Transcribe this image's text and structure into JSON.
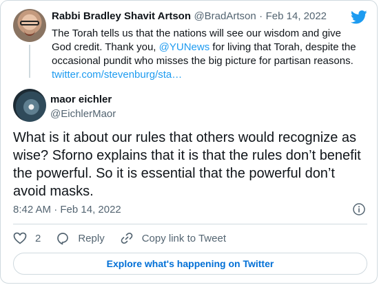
{
  "quoted_tweet": {
    "author_name": "Rabbi Bradley Shavit Artson",
    "author_handle": "@BradArtson",
    "separator": "·",
    "date": "Feb 14, 2022",
    "text_before_mention": "The Torah tells us that the nations will see our wisdom and give God credit. Thank you, ",
    "mention": "@YUNews",
    "text_after_mention": " for living that Torah, despite the occasional pundit who misses the big picture for partisan reasons.",
    "link": "twitter.com/stevenburg/sta…"
  },
  "main_tweet": {
    "author_name": "maor eichler",
    "author_handle": "@EichlerMaor",
    "text": "What is it about our rules that others would recognize as wise? Sforno explains that it is that the rules don’t benefit the powerful. So it is essential that the powerful don’t avoid masks.",
    "timestamp": "8:42 AM · Feb 14, 2022"
  },
  "actions": {
    "like_count": "2",
    "reply_label": "Reply",
    "copy_link_label": "Copy link to Tweet"
  },
  "footer": {
    "explore_label": "Explore what's happening on Twitter"
  },
  "icons": {
    "brand": "twitter-bird-icon",
    "info": "info-icon",
    "like": "heart-icon",
    "reply": "reply-bubble-icon",
    "copy": "link-icon"
  },
  "colors": {
    "brand_blue": "#1d9bf0",
    "explore_blue": "#006fd6",
    "secondary_text": "#536471",
    "border": "#cfd9de"
  }
}
